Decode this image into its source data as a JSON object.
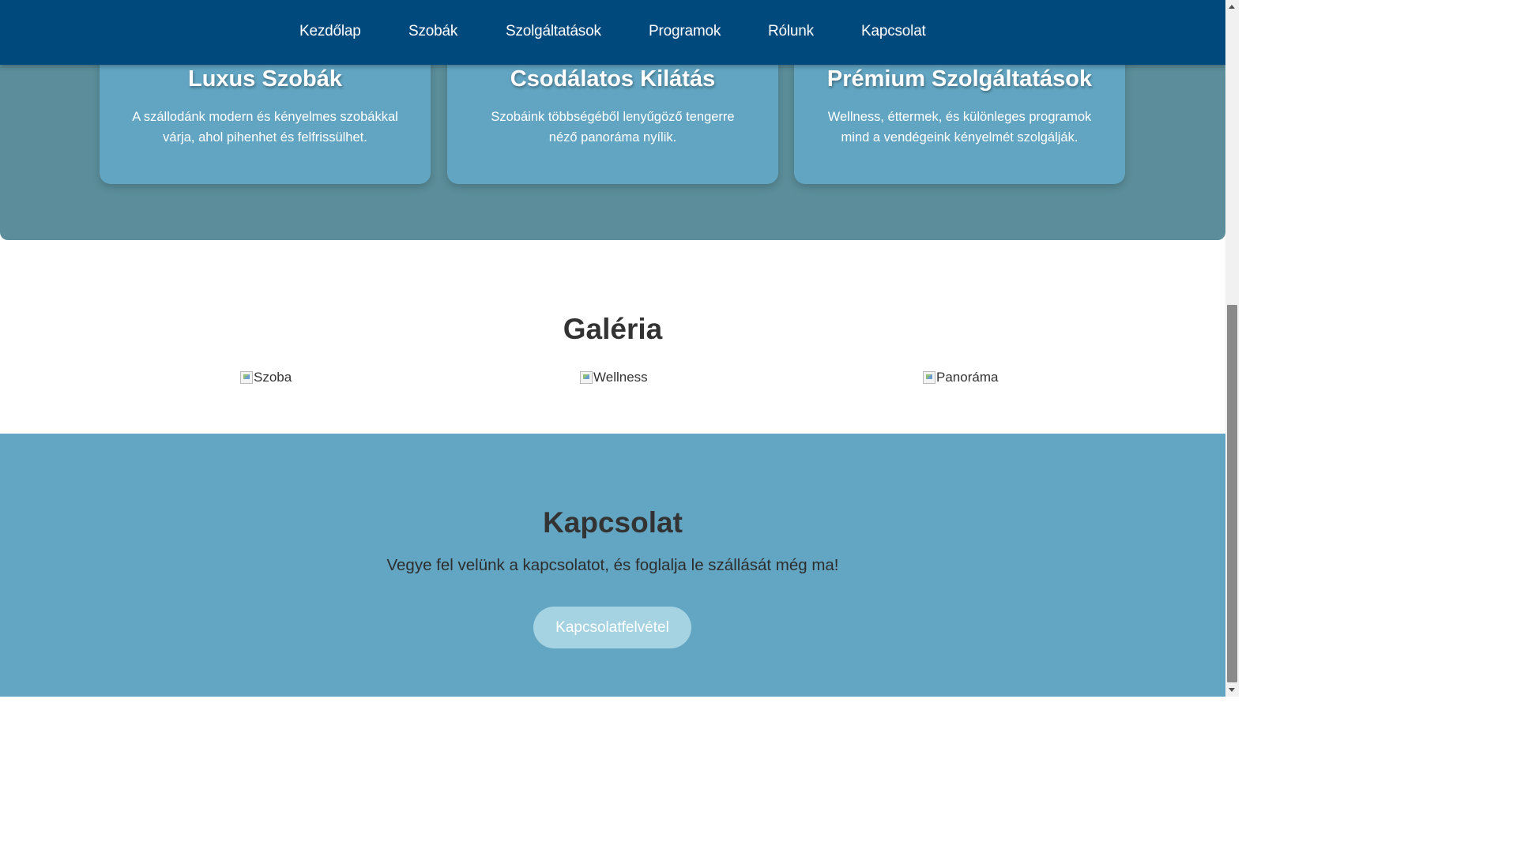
{
  "nav": {
    "items": [
      {
        "label": "Kezdőlap"
      },
      {
        "label": "Szobák"
      },
      {
        "label": "Szolgáltatások"
      },
      {
        "label": "Programok"
      },
      {
        "label": "Rólunk"
      },
      {
        "label": "Kapcsolat"
      }
    ]
  },
  "features": [
    {
      "title": "Luxus Szobák",
      "text": "A szállodánk modern és kényelmes szobákkal várja, ahol pihenhet és felfrissülhet."
    },
    {
      "title": "Csodálatos Kilátás",
      "text": "Szobáink többségéből lenyűgöző tengerre néző panoráma nyílik."
    },
    {
      "title": "Prémium Szolgáltatások",
      "text": "Wellness, éttermek, és különleges programok mind a vendégeink kényelmét szolgálják."
    }
  ],
  "gallery": {
    "title": "Galéria",
    "images": [
      {
        "alt": "Szoba"
      },
      {
        "alt": "Wellness"
      },
      {
        "alt": "Panoráma"
      }
    ]
  },
  "contact": {
    "title": "Kapcsolat",
    "text": "Vegye fel velünk a kapcsolatot, és foglalja le szállását még ma!",
    "button_label": "Kapcsolatfelvétel"
  },
  "colors": {
    "nav_bg": "#00497c",
    "hero_bg": "#5b8e9a",
    "card_bg": "#62a5c2",
    "contact_bg": "#63a6c3",
    "button_bg": "#a6d3e2"
  }
}
